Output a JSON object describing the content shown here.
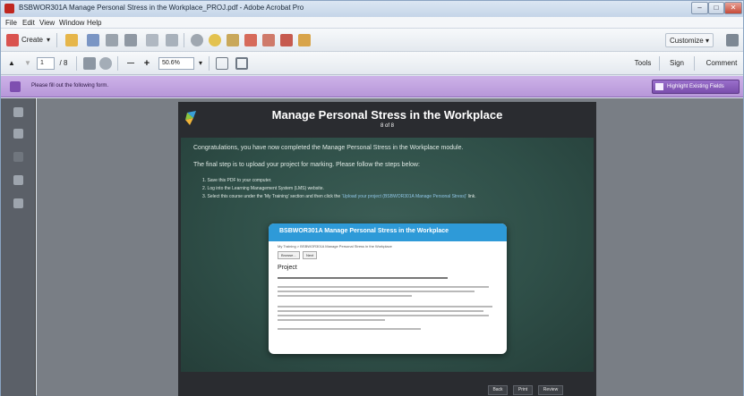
{
  "window": {
    "title": "BSBWOR301A Manage Personal Stress in the Workplace_PROJ.pdf - Adobe Acrobat Pro"
  },
  "menu": [
    "File",
    "Edit",
    "View",
    "Window",
    "Help"
  ],
  "toolbar": {
    "create_label": "Create",
    "customize_label": "Customize"
  },
  "nav_toolbar": {
    "page_current": "1",
    "page_total": "/ 8",
    "zoom": "50.6%",
    "tools_label": "Tools",
    "sign_label": "Sign",
    "comment_label": "Comment"
  },
  "form_bar": {
    "message": "Please fill out the following form.",
    "highlight_label": "Highlight Existing Fields"
  },
  "document": {
    "title": "Manage Personal Stress in the Workplace",
    "page_indicator": "8 of 8",
    "congrats": "Congratulations, you have now completed the Manage Personal Stress in the Workplace module.",
    "final_step": "The final step is to upload your project for marking. Please follow the steps below:",
    "steps": [
      "1.  Save this PDF to your computer.",
      "2.  Log into the Learning Management System (LMS) website.",
      "3.  Select this course under the 'My Training' section and then click the"
    ],
    "step3_link": "'Upload your project (BSBWOR301A Manage Personal Stress)'",
    "step3_end": "link.",
    "popup": {
      "title": "BSBWOR301A Manage Personal Stress in the Workplace",
      "breadcrumb": "My Training > BSBWOR301A Manage Personal Stress in the Workplace",
      "browse_label": "Browse...",
      "next_label": "Next",
      "heading": "Project"
    },
    "nav_buttons": [
      "Back",
      "Print",
      "Review"
    ]
  }
}
